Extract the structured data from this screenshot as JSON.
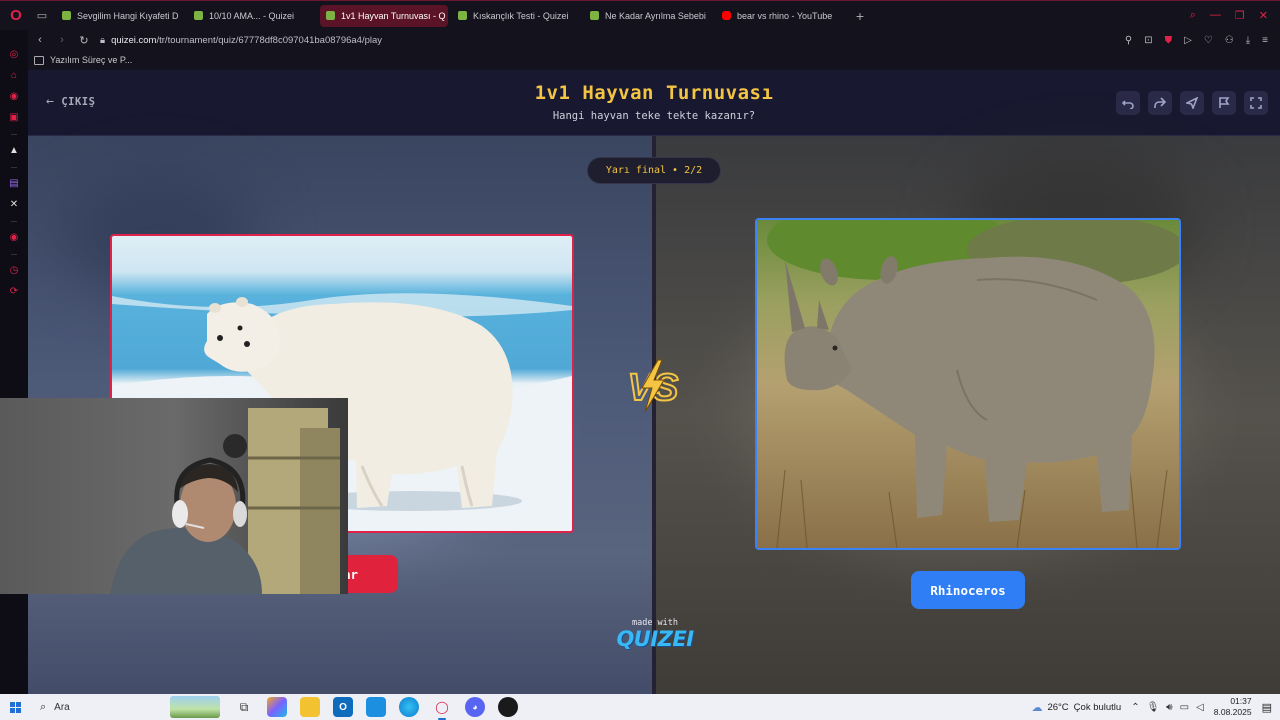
{
  "browser": {
    "tabs": [
      {
        "label": "Sevgilim Hangi Kıyafeti D",
        "favicon": "quizei",
        "active": false
      },
      {
        "label": "10/10 AMA... - Quizei",
        "favicon": "quizei",
        "active": false
      },
      {
        "label": "1v1 Hayvan Turnuvası - Q",
        "favicon": "quizei",
        "active": true
      },
      {
        "label": "Kıskançlık Testi - Quizei",
        "favicon": "quizei",
        "active": false
      },
      {
        "label": "Ne Kadar Ayrılma Sebebi",
        "favicon": "quizei",
        "active": false
      },
      {
        "label": "bear vs rhino - YouTube",
        "favicon": "youtube",
        "active": false
      }
    ],
    "url_host": "quizei.com",
    "url_path": "/tr/tournament/quiz/67778df8c097041ba08796a4/play",
    "bookmark": "Yazılım Süreç ve P..."
  },
  "app": {
    "exit_label": "ÇIKIŞ",
    "title": "1v1 Hayvan Turnuvası",
    "subtitle": "Hangi hayvan teke tekte kazanır?",
    "round_badge": "Yarı final • 2/2",
    "vs_text": "VS",
    "left_choice": "Bear",
    "right_choice": "Rhinoceros",
    "made_with": "made with",
    "brand": "QUIZEI"
  },
  "taskbar": {
    "search_placeholder": "Ara",
    "weather_temp": "26°C",
    "weather_desc": "Çok bulutlu",
    "time": "01:37",
    "date": "8.08.2025"
  },
  "colors": {
    "accent_gold": "#f4c542",
    "bear_red": "#e0223c",
    "rhino_blue": "#2f7ef5",
    "browser_red": "#e0224a"
  }
}
